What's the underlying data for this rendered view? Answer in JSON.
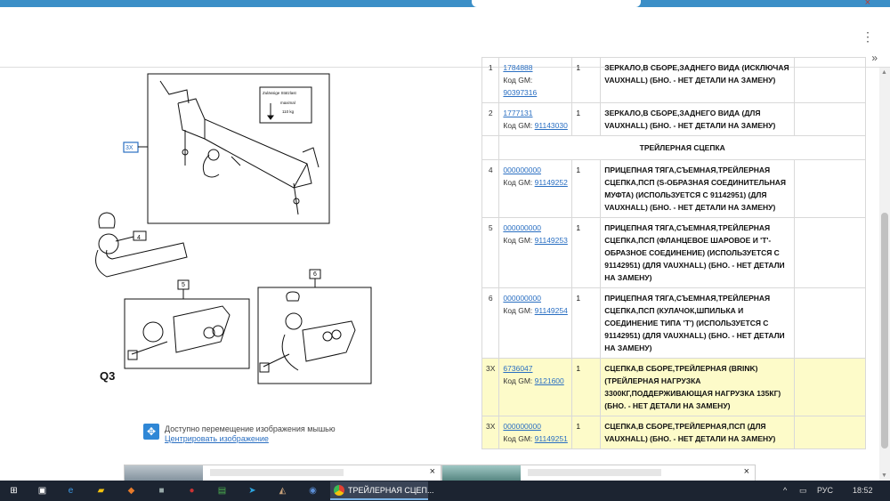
{
  "browser": {
    "menu_glyph": "⋮",
    "more_glyph": "»",
    "close_glyph": "×"
  },
  "diagram": {
    "label": "Q3",
    "callouts": [
      "3X",
      "4",
      "5",
      "6"
    ],
    "sticker": [
      "Zulässige Stützlast",
      "maximal",
      "110 kg"
    ]
  },
  "hint": {
    "icon": "move-icon",
    "text": "Доступно перемещение изображения мышью",
    "link": "Центрировать изображение"
  },
  "table": {
    "rows": [
      {
        "pos": "1",
        "part": "1784888",
        "gm_label": "Код GM:",
        "gm": "90397316",
        "qty": "1",
        "desc": "ЗЕРКАЛО,В СБОРЕ,ЗАДНЕГО ВИДА (ИСКЛЮЧАЯ VAUXHALL) (БНО. - НЕТ ДЕТАЛИ НА ЗАМЕНУ)",
        "highlight": false
      },
      {
        "pos": "2",
        "part": "1777131",
        "gm_label": "Код GM:",
        "gm": "91143030",
        "qty": "1",
        "desc": "ЗЕРКАЛО,В СБОРЕ,ЗАДНЕГО ВИДА (ДЛЯ VAUXHALL) (БНО. - НЕТ ДЕТАЛИ НА ЗАМЕНУ)",
        "highlight": false
      }
    ],
    "section": "ТРЕЙЛЕРНАЯ СЦЕПКА",
    "rows2": [
      {
        "pos": "4",
        "part": "000000000",
        "gm_label": "Код GM:",
        "gm": "91149252",
        "qty": "1",
        "desc": "ПРИЦЕПНАЯ ТЯГА,СЪЕМНАЯ,ТРЕЙЛЕРНАЯ СЦЕПКА,ПСП (S-ОБРАЗНАЯ СОЕДИНИТЕЛЬНАЯ МУФТА) (ИСПОЛЬЗУЕТСЯ С 91142951) (ДЛЯ VAUXHALL) (БНО. - НЕТ ДЕТАЛИ НА ЗАМЕНУ)",
        "highlight": false
      },
      {
        "pos": "5",
        "part": "000000000",
        "gm_label": "Код GM:",
        "gm": "91149253",
        "qty": "1",
        "desc": "ПРИЦЕПНАЯ ТЯГА,СЪЕМНАЯ,ТРЕЙЛЕРНАЯ СЦЕПКА,ПСП (ФЛАНЦЕВОЕ ШАРОВОЕ И 'T'-ОБРАЗНОЕ СОЕДИНЕНИЕ) (ИСПОЛЬЗУЕТСЯ С 91142951) (ДЛЯ VAUXHALL) (БНО. - НЕТ ДЕТАЛИ НА ЗАМЕНУ)",
        "highlight": false
      },
      {
        "pos": "6",
        "part": "000000000",
        "gm_label": "Код GM:",
        "gm": "91149254",
        "qty": "1",
        "desc": "ПРИЦЕПНАЯ ТЯГА,СЪЕМНАЯ,ТРЕЙЛЕРНАЯ СЦЕПКА,ПСП (КУЛАЧОК,ШПИЛЬКА И СОЕДИНЕНИЕ ТИПА 'T') (ИСПОЛЬЗУЕТСЯ С 91142951) (ДЛЯ VAUXHALL) (БНО. - НЕТ ДЕТАЛИ НА ЗАМЕНУ)",
        "highlight": false
      },
      {
        "pos": "3X",
        "part": "6736047",
        "gm_label": "Код GM:",
        "gm": "9121600",
        "qty": "1",
        "desc": "СЦЕПКА,В СБОРЕ,ТРЕЙЛЕРНАЯ (BRINK) (ТРЕЙЛЕРНАЯ НАГРУЗКА 3300КГ,ПОДДЕРЖИВАЮЩАЯ НАГРУЗКА 135КГ) (БНО. - НЕТ ДЕТАЛИ НА ЗАМЕНУ)",
        "highlight": true
      },
      {
        "pos": "3X",
        "part": "000000000",
        "gm_label": "Код GM:",
        "gm": "91149251",
        "qty": "1",
        "desc": "СЦЕПКА,В СБОРЕ,ТРЕЙЛЕРНАЯ,ПСП (ДЛЯ VAUXHALL) (БНО. - НЕТ ДЕТАЛИ НА ЗАМЕНУ)",
        "highlight": true
      }
    ]
  },
  "taskbar": {
    "app_label": "ТРЕЙЛЕРНАЯ СЦЕП...",
    "lang": "РУС",
    "time": "18:52"
  },
  "colors": {
    "highlight": "#fdfbc9",
    "link": "#2a6fc2",
    "taskbar": "#1c2431"
  }
}
